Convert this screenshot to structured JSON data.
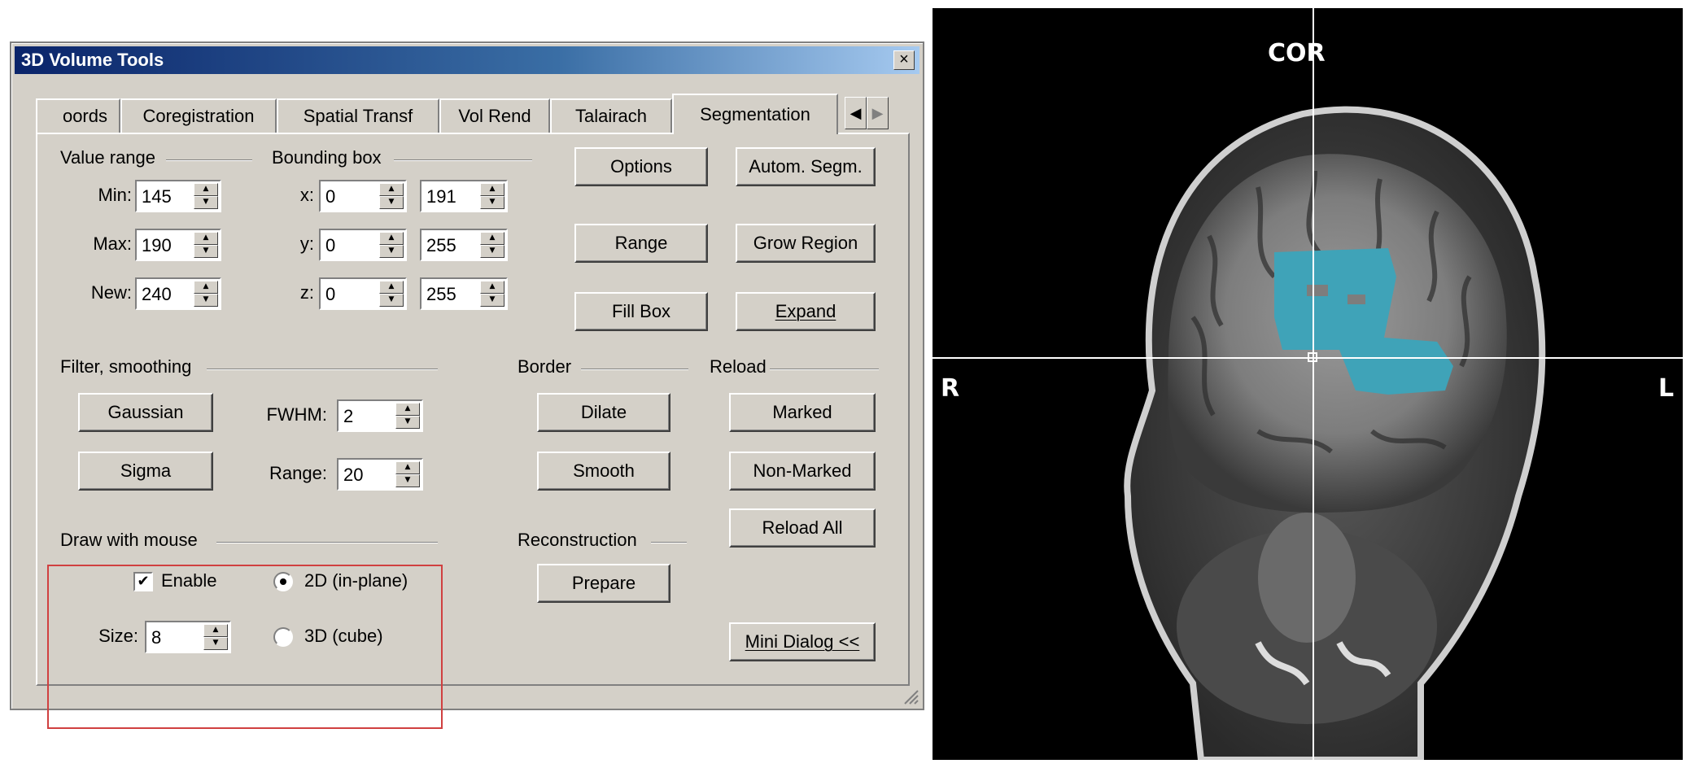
{
  "dialog": {
    "title": "3D Volume Tools",
    "close_glyph": "×",
    "tabs": [
      "oords",
      "Coregistration",
      "Spatial Transf",
      "Vol Rend",
      "Talairach",
      "Segmentation"
    ],
    "active_tab": "Segmentation",
    "tab_scroll_left": "◀",
    "tab_scroll_right": "▶",
    "value_range": {
      "label": "Value range",
      "min_label": "Min:",
      "min": "145",
      "max_label": "Max:",
      "max": "190",
      "new_label": "New:",
      "new": "240"
    },
    "bounding_box": {
      "label": "Bounding box",
      "x_label": "x:",
      "x_from": "0",
      "x_to": "191",
      "y_label": "y:",
      "y_from": "0",
      "y_to": "255",
      "z_label": "z:",
      "z_from": "0",
      "z_to": "255"
    },
    "buttons": {
      "options": "Options",
      "autom_segm": "Autom. Segm.",
      "range": "Range",
      "grow_region": "Grow Region",
      "fill_box": "Fill Box",
      "expand": "Expand",
      "gaussian": "Gaussian",
      "sigma": "Sigma",
      "dilate": "Dilate",
      "smooth": "Smooth",
      "marked": "Marked",
      "non_marked": "Non-Marked",
      "reload_all": "Reload All",
      "prepare": "Prepare",
      "mini_dialog": "Mini Dialog <<"
    },
    "filter": {
      "label": "Filter, smoothing",
      "fwhm_label": "FWHM:",
      "fwhm": "2",
      "range_label": "Range:",
      "range": "20"
    },
    "border_label": "Border",
    "reload_label": "Reload",
    "reconstruction_label": "Reconstruction",
    "draw": {
      "label": "Draw with mouse",
      "enable_label": "Enable",
      "enable_checked": true,
      "mode_2d": "2D (in-plane)",
      "mode_3d": "3D (cube)",
      "selected_mode": "2D (in-plane)",
      "size_label": "Size:",
      "size": "8"
    }
  },
  "viewer": {
    "view_label": "COR",
    "left_side_label": "R",
    "right_side_label": "L",
    "segmentation_color": "#3fa3b8"
  }
}
